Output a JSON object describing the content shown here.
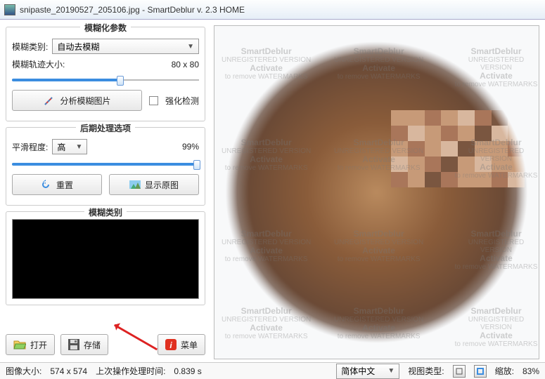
{
  "window": {
    "title": "snipaste_20190527_205106.jpg - SmartDeblur v. 2.3 HOME"
  },
  "panel_blur": {
    "legend": "模糊化参数",
    "type_label": "模糊类别:",
    "type_value": "自动去模糊",
    "track_label": "模糊轨迹大小:",
    "track_value": "80 x 80",
    "track_pct": 58,
    "analyze_btn": "分析模糊图片",
    "enhance_chk": "强化检测"
  },
  "panel_post": {
    "legend": "后期处理选项",
    "smooth_label": "平滑程度:",
    "smooth_value": "高",
    "smooth_pct_text": "99%",
    "smooth_pct": 99,
    "reset_btn": "重置",
    "original_btn": "显示原图"
  },
  "panel_kernel": {
    "legend": "模糊类别"
  },
  "toolbar": {
    "open": "打开",
    "save": "存储",
    "menu": "菜单"
  },
  "status": {
    "size_label": "图像大小:",
    "size_value": "574 x 574",
    "time_label": "上次操作处理时间:",
    "time_value": "0.839 s",
    "lang_value": "简体中文",
    "viewtype_label": "视图类型:",
    "zoom_label": "缩放:",
    "zoom_value": "83%"
  },
  "watermark": {
    "line1": "SmartDeblur",
    "line2": "UNREGISTERED VERSION",
    "line3": "Activate",
    "line4": "to remove WATERMARKS"
  }
}
